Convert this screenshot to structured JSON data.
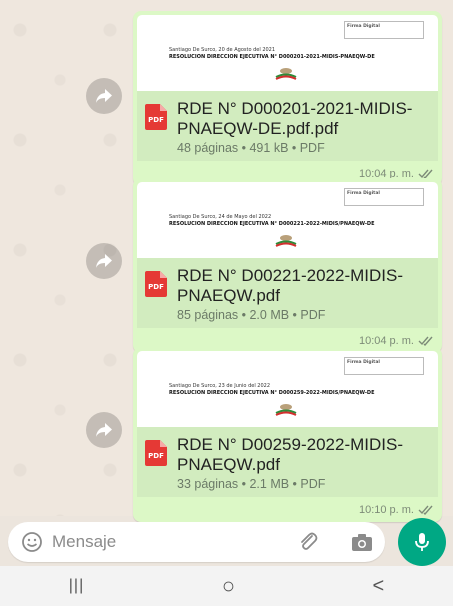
{
  "messages": [
    {
      "preview": {
        "date_line": "Santiago De Surco, 20 de Agosto del 2021",
        "resolution_line": "RESOLUCION DIRECCION EJECUTIVA N°   D000201-2021-MIDIS-PNAEQW-DE",
        "stamp_title": "Firma Digital"
      },
      "icon_text": "PDF",
      "file_name": "RDE N° D000201-2021-MIDIS-PNAEQW-DE.pdf.pdf",
      "meta": "48 páginas • 491 kB • PDF",
      "time": "10:04 p. m."
    },
    {
      "preview": {
        "date_line": "Santiago De Surco, 24 de Mayo del 2022",
        "resolution_line": "RESOLUCION DIRECCION EJECUTIVA N°   D000221-2022-MIDIS/PNAEQW-DE",
        "stamp_title": "Firma Digital"
      },
      "icon_text": "PDF",
      "file_name": "RDE N° D00221-2022-MIDIS-PNAEQW.pdf",
      "meta": "85 páginas • 2.0 MB • PDF",
      "time": "10:04 p. m."
    },
    {
      "preview": {
        "date_line": "Santiago De Surco, 23 de Junio del 2022",
        "resolution_line": "RESOLUCION DIRECCION EJECUTIVA N°   D000259-2022-MIDIS/PNAEQW-DE",
        "stamp_title": "Firma Digital"
      },
      "icon_text": "PDF",
      "file_name": "RDE N° D00259-2022-MIDIS-PNAEQW.pdf",
      "meta": "33 páginas • 2.1 MB • PDF",
      "time": "10:10 p. m."
    }
  ],
  "input": {
    "placeholder": "Mensaje"
  },
  "navbar": {
    "recents_glyph": "|||",
    "home_glyph": "○",
    "back_glyph": "<"
  },
  "colors": {
    "bubble": "#dcf8c6",
    "doc_strip": "#d2ecbf",
    "accent": "#00a884",
    "pdf_red": "#e53935",
    "read_ticks": "#7d8b78"
  },
  "icons": [
    "forward-icon",
    "pdf-icon",
    "double-check-icon",
    "emoji-icon",
    "attach-icon",
    "camera-icon",
    "mic-icon"
  ]
}
